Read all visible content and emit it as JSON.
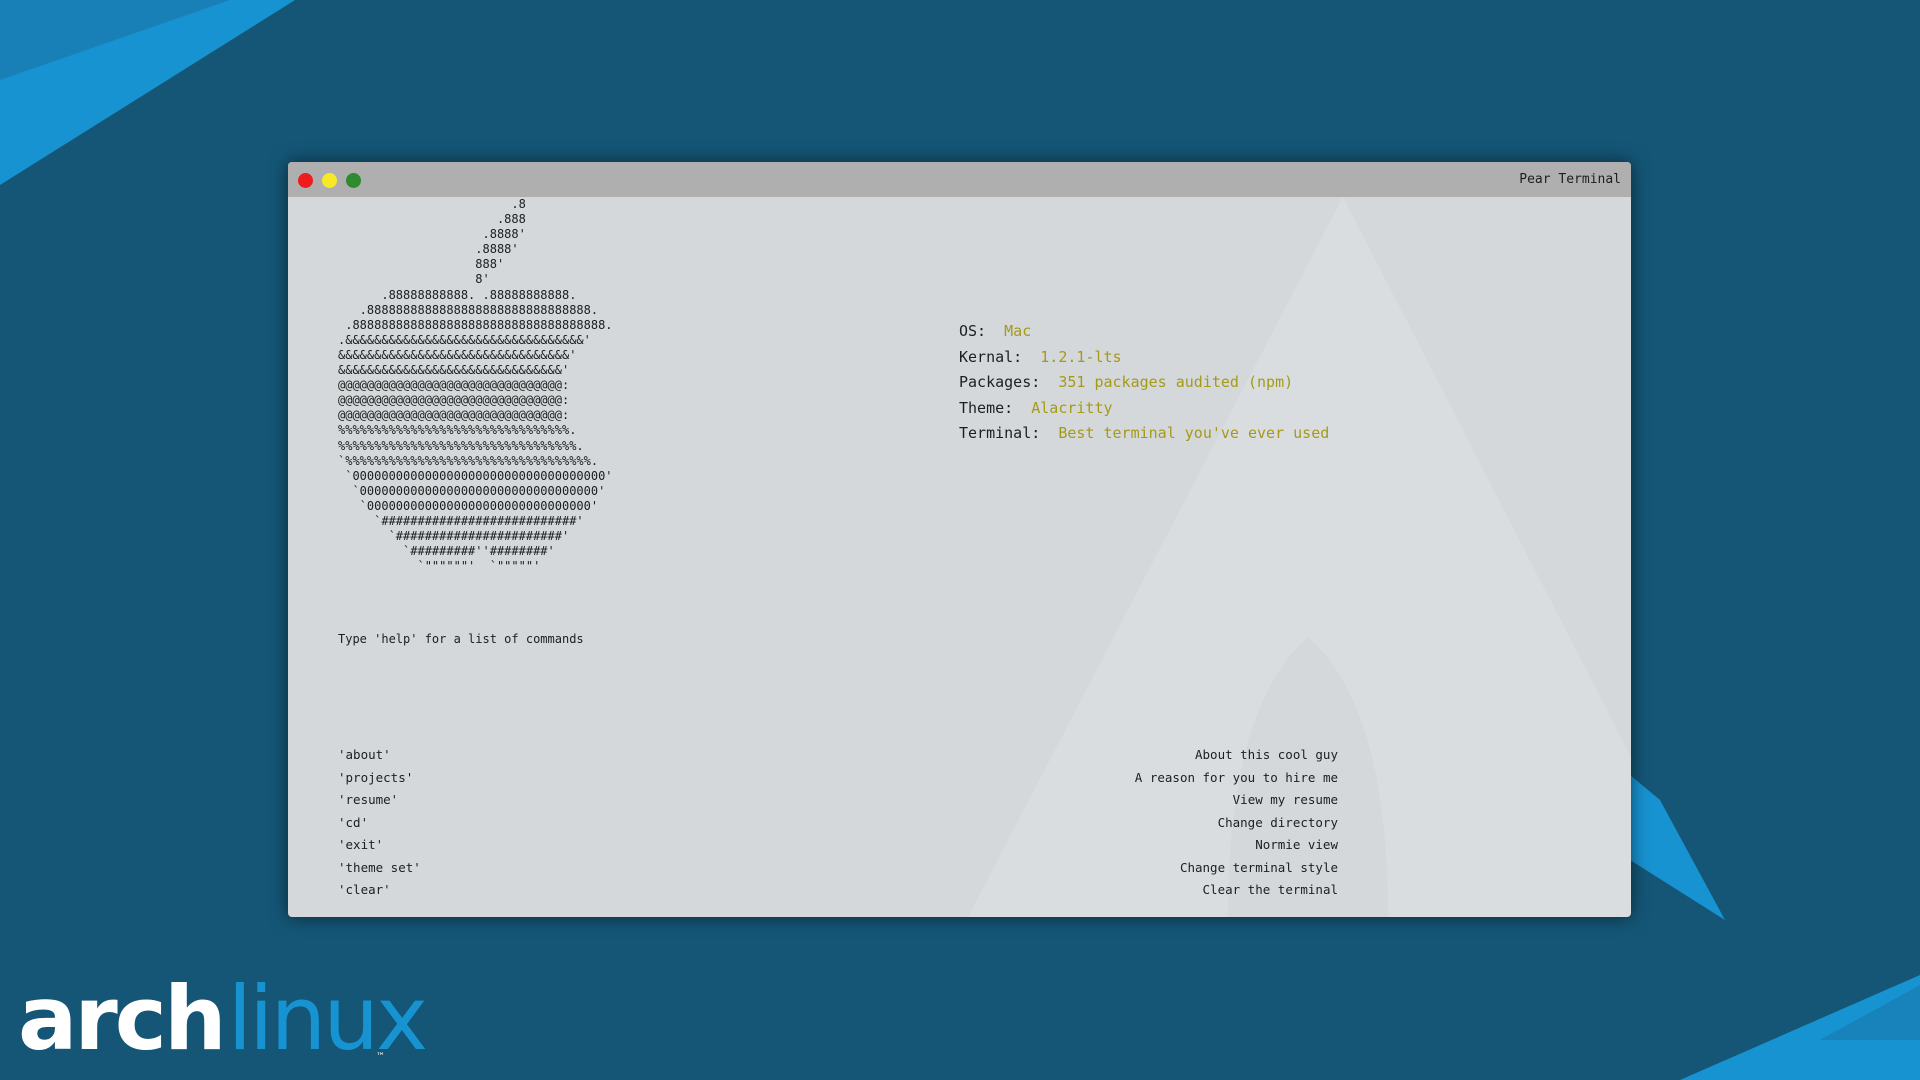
{
  "desktop": {
    "background_color": "#155677",
    "accent_color": "#1793d1",
    "logo": {
      "part1": "arch",
      "part2": "linux",
      "tm": "™"
    }
  },
  "window": {
    "title": "Pear Terminal",
    "traffic_lights": [
      "close",
      "minimize",
      "maximize"
    ]
  },
  "terminal": {
    "ascii_art": "                        .8\n                      .888\n                    .8888'\n                   .8888'\n                   888'\n                   8'\n      .88888888888. .88888888888.\n   .8888888888888888888888888888888.\n .88888888888888888888888888888888888.\n.&&&&&&&&&&&&&&&&&&&&&&&&&&&&&&&&&'\n&&&&&&&&&&&&&&&&&&&&&&&&&&&&&&&&'\n&&&&&&&&&&&&&&&&&&&&&&&&&&&&&&&'\n@@@@@@@@@@@@@@@@@@@@@@@@@@@@@@@:\n@@@@@@@@@@@@@@@@@@@@@@@@@@@@@@@:\n@@@@@@@@@@@@@@@@@@@@@@@@@@@@@@@:\n%%%%%%%%%%%%%%%%%%%%%%%%%%%%%%%%.\n%%%%%%%%%%%%%%%%%%%%%%%%%%%%%%%%%.\n`%%%%%%%%%%%%%%%%%%%%%%%%%%%%%%%%%%.\n `00000000000000000000000000000000000'\n  `000000000000000000000000000000000'\n   `0000000000000000000000000000000'\n     `###########################'\n       `#######################'\n         `#########''########'\n           `\"\"\"\"\"\"'  `\"\"\"\"\"'",
    "sysinfo": [
      {
        "label": "OS:",
        "value": "Mac"
      },
      {
        "label": "Kernal:",
        "value": "1.2.1-lts"
      },
      {
        "label": "Packages:",
        "value": "351 packages audited (npm)"
      },
      {
        "label": "Theme:",
        "value": "Alacritty"
      },
      {
        "label": "Terminal:",
        "value": "Best terminal you've ever used"
      }
    ],
    "hint": "Type 'help' for a list of commands",
    "commands": [
      {
        "name": "'about'",
        "desc": "About this cool guy"
      },
      {
        "name": "'projects'",
        "desc": "A reason for you to hire me"
      },
      {
        "name": "'resume'",
        "desc": "View my resume"
      },
      {
        "name": "'cd'",
        "desc": "Change directory"
      },
      {
        "name": "'exit'",
        "desc": "Normie view"
      },
      {
        "name": "'theme set'",
        "desc": "Change terminal style"
      },
      {
        "name": "'clear'",
        "desc": "Clear the terminal"
      }
    ],
    "value_color": "#a59a18"
  }
}
